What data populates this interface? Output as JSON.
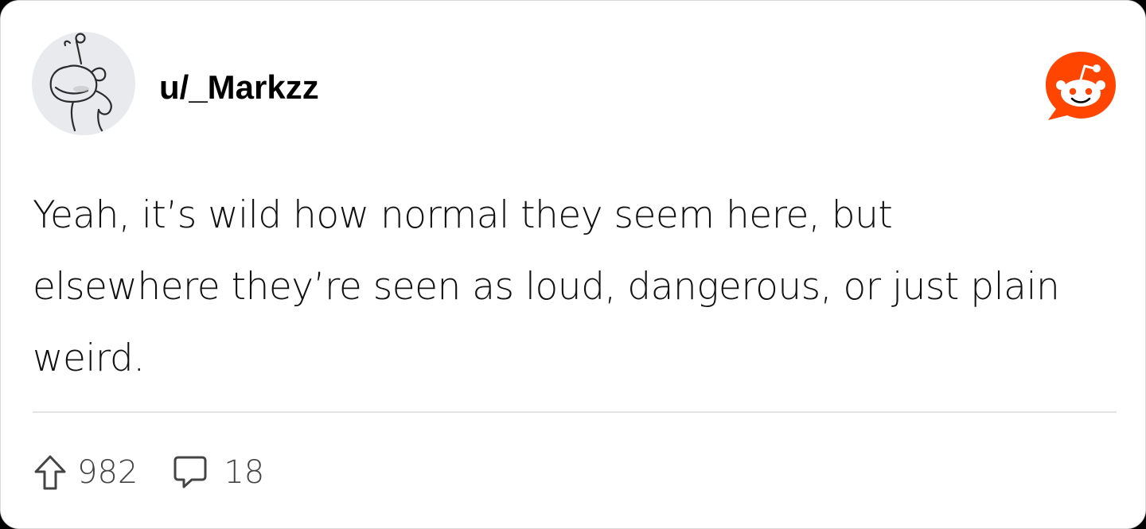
{
  "post": {
    "username": "u/_Markzz",
    "body": "Yeah, it’s wild how normal they seem here, but elsewhere they’re seen as loud, dangerous, or just plain weird.",
    "upvotes": "982",
    "comments": "18"
  },
  "icons": {
    "avatar": "snoo-avatar-icon",
    "brand": "reddit-logo-icon",
    "upvote": "upvote-arrow-icon",
    "comment": "comment-bubble-icon"
  },
  "colors": {
    "brand": "#ff4500",
    "text": "#111111",
    "muted": "#444444",
    "divider": "#e4e4e4",
    "avatar_bg": "#e9eaee"
  }
}
